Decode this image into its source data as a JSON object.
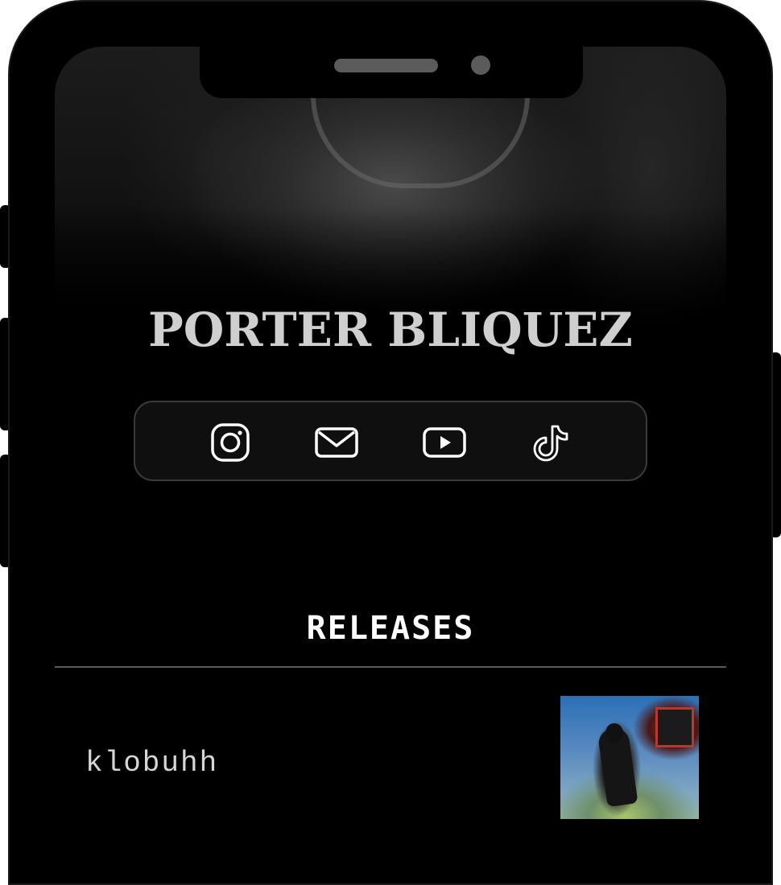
{
  "profile": {
    "artist_name": "PORTER BLIQUEZ"
  },
  "social_links": [
    {
      "name": "instagram",
      "icon": "instagram-icon"
    },
    {
      "name": "email",
      "icon": "mail-icon"
    },
    {
      "name": "youtube",
      "icon": "youtube-icon"
    },
    {
      "name": "tiktok",
      "icon": "tiktok-icon"
    }
  ],
  "releases": {
    "heading": "RELEASES",
    "items": [
      {
        "title": "klobuhh",
        "cover": "album-cover-image"
      }
    ]
  },
  "colors": {
    "background": "#000000",
    "artist_name": "#cfcfcf",
    "heading": "#ffffff",
    "release_title": "#d6d6d6",
    "social_bar_border": "#3a3a3a",
    "divider": "#5a5a5a"
  }
}
